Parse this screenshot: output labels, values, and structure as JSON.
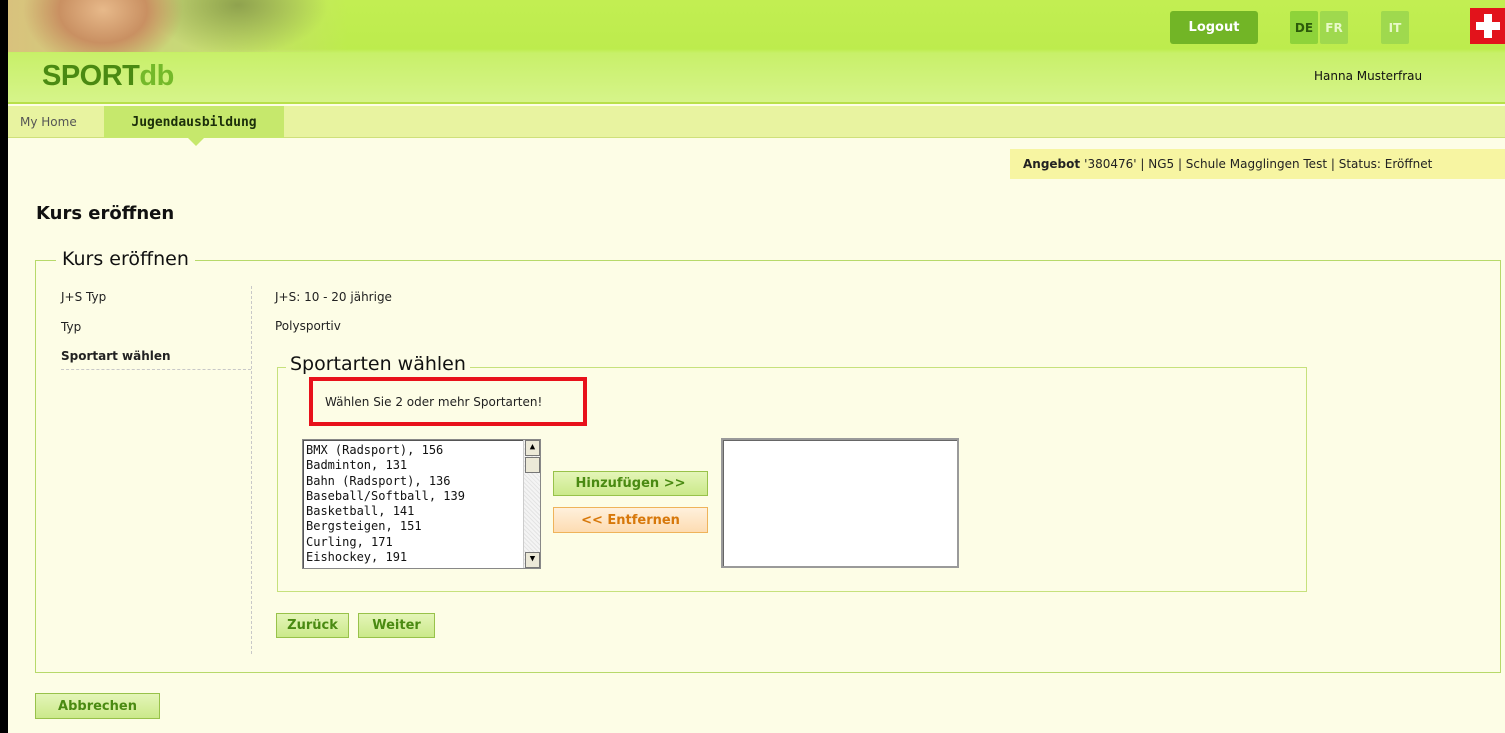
{
  "header": {
    "logo_part1": "SPORT",
    "logo_part2": "db",
    "logout_label": "Logout",
    "languages": [
      "DE",
      "FR",
      "IT"
    ],
    "user_name": "Hanna Musterfrau"
  },
  "tabs": [
    {
      "label": "My Home"
    },
    {
      "label": "Jugendausbildung",
      "active": true
    }
  ],
  "angebot": {
    "label": "Angebot",
    "text": "'380476' | NG5 | Schule Magglingen Test | Status: Eröffnet"
  },
  "page_title": "Kurs eröffnen",
  "form": {
    "legend": "Kurs eröffnen",
    "rows": [
      {
        "label": "J+S Typ",
        "value": "J+S: 10 - 20 jährige"
      },
      {
        "label": "Typ",
        "value": "Polysportiv"
      },
      {
        "label": "Sportart wählen"
      }
    ],
    "sport_section": {
      "legend": "Sportarten wählen",
      "hint": "Wählen Sie 2 oder mehr Sportarten!",
      "available": [
        "BMX (Radsport), 156",
        "Badminton, 131",
        "Bahn (Radsport), 136",
        "Baseball/Softball, 139",
        "Basketball, 141",
        "Bergsteigen, 151",
        "Curling, 171",
        "Eishockey, 191"
      ],
      "add_label": "Hinzufügen >>",
      "remove_label": "<< Entfernen",
      "selected": []
    },
    "back_label": "Zurück",
    "next_label": "Weiter"
  },
  "cancel_label": "Abbrechen",
  "colors": {
    "header_green": "#c2ee52",
    "accent_green": "#72b526",
    "highlight_red": "#e8111b",
    "remove_orange": "#d7780a"
  }
}
